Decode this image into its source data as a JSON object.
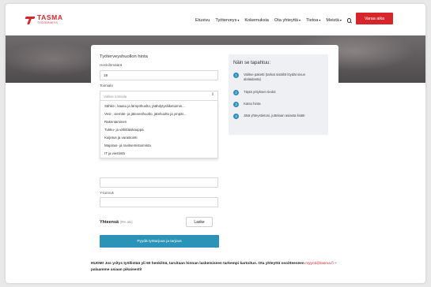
{
  "header": {
    "logo": {
      "name": "TASMA",
      "sub": "TYÖTERVEYS"
    },
    "nav": [
      {
        "label": "Etusivu",
        "dropdown": false
      },
      {
        "label": "Työterveys",
        "dropdown": true
      },
      {
        "label": "Kokemuksia",
        "dropdown": false
      },
      {
        "label": "Ota yhteyttä",
        "dropdown": true
      },
      {
        "label": "Tietoa",
        "dropdown": true
      },
      {
        "label": "Meistä",
        "dropdown": true
      }
    ],
    "caret": "▾",
    "cta_label": "Varaa aika"
  },
  "form": {
    "title": "Työterveyshuollon hinta",
    "persons_label": "Henkilömäärä",
    "persons_value": "18",
    "industry_label": "Toimiala",
    "industry_placeholder": "Valitse toimiala",
    "industry_options": [
      "Sähkö-, kaasu ja lämpöhuolto, jäähdytysliiketoimin...",
      "Vesi-, viemäri- ja jätevesihuolto, jätehuolto ja ympär...",
      "Rakentaminen",
      "Tukku- ja vähittäiskauppa",
      "Kuljetus ja varastointi",
      "Majoitus- ja ravitsemistoiminta",
      "IT ja viestintä"
    ],
    "ytunnus_label": "Y-tunnus",
    "total_label": "Yhteensä",
    "total_vat": "(0% alv)",
    "calculate_label": "Laske",
    "submit_label": "Pyydä työtarjous ja tarjous"
  },
  "steps": {
    "title": "Näin se tapahtuu:",
    "items": [
      {
        "num": "1",
        "text": "Valitse paketti (tarkat sisällöt löydät sivun alalaidasta)"
      },
      {
        "num": "2",
        "text": "Täytä yrityksen tiedot"
      },
      {
        "num": "3",
        "text": "Katso hinta"
      },
      {
        "num": "4",
        "text": "Jätä yhteystietosi, juttelaan asiasta lisää!"
      }
    ]
  },
  "notice": {
    "text": "HUOM! Jos yritys työllistää yli 60 henkilöä, tarvitaan hinnan laskemiseen tarkempi kartoitus. Ota yhteyttä osoitteeseen",
    "email": "myynti@tasma.fi",
    "suffix": "– palaamme asiaan pikaisesti!"
  },
  "colors": {
    "brand": "#d6262c",
    "accent": "#2b93b7"
  }
}
